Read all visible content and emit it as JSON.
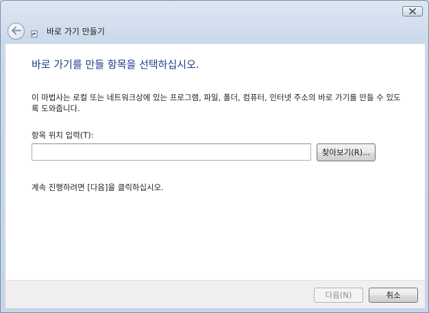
{
  "window": {
    "title": "바로 가기 만들기",
    "close_icon": "close-x-icon",
    "back_icon": "back-arrow-icon",
    "wizard_icon": "shortcut-wizard-icon"
  },
  "main": {
    "heading": "바로 가기를 만들 항목을 선택하십시오.",
    "description": "이 마법사는 로컬 또는 네트워크상에 있는 프로그램, 파일, 폴더, 컴퓨터, 인터넷 주소의 바로 가기를 만들 수 있도록 도와줍니다.",
    "location_label": "항목 위치 입력(T):",
    "location_value": "",
    "browse_label": "찾아보기(R)...",
    "instruction": "계속 진행하려면 [다음]을 클릭하십시오."
  },
  "footer": {
    "next_label": "다음(N)",
    "cancel_label": "취소"
  },
  "colors": {
    "heading": "#1e3a8c",
    "frame": "#cbd9ea",
    "footer": "#f0f0f0",
    "disabled_text": "#8d8d8d"
  }
}
